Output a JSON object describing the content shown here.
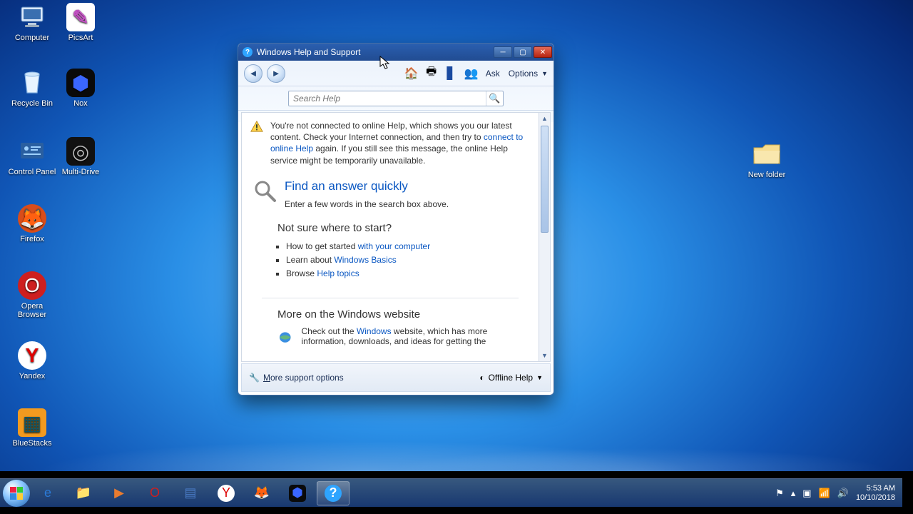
{
  "desktop_icons": {
    "computer": "Computer",
    "picsart": "PicsArt",
    "recycle_bin": "Recycle Bin",
    "nox": "Nox",
    "control_panel": "Control Panel",
    "multi_drive": "Multi-Drive",
    "firefox": "Firefox",
    "opera": "Opera Browser",
    "yandex": "Yandex",
    "bluestacks": "BlueStacks",
    "new_folder": "New folder"
  },
  "window": {
    "title": "Windows Help and Support",
    "toolbar": {
      "ask": "Ask",
      "options": "Options"
    },
    "search_placeholder": "Search Help",
    "warning": {
      "part1": "You're not connected to online Help, which shows you our latest content. Check your Internet connection, and then try to ",
      "link": "connect to online Help",
      "part2": " again. If you still see this message, the online Help service might be temporarily unavailable."
    },
    "find": {
      "heading": "Find an answer quickly",
      "sub": "Enter a few words in the search box above."
    },
    "notsure": {
      "heading": "Not sure where to start?",
      "items": [
        {
          "pre": "How to get started ",
          "link": "with your computer"
        },
        {
          "pre": "Learn about ",
          "link": "Windows Basics"
        },
        {
          "pre": "Browse ",
          "link": "Help topics"
        }
      ]
    },
    "more": {
      "heading": "More on the Windows website",
      "pre": "Check out the ",
      "link": "Windows",
      "post": " website, which has more information, downloads, and ideas for getting the"
    },
    "footer": {
      "more_support": "More support options",
      "offline": "Offline Help"
    }
  },
  "tray": {
    "time": "5:53 AM",
    "date": "10/10/2018"
  }
}
